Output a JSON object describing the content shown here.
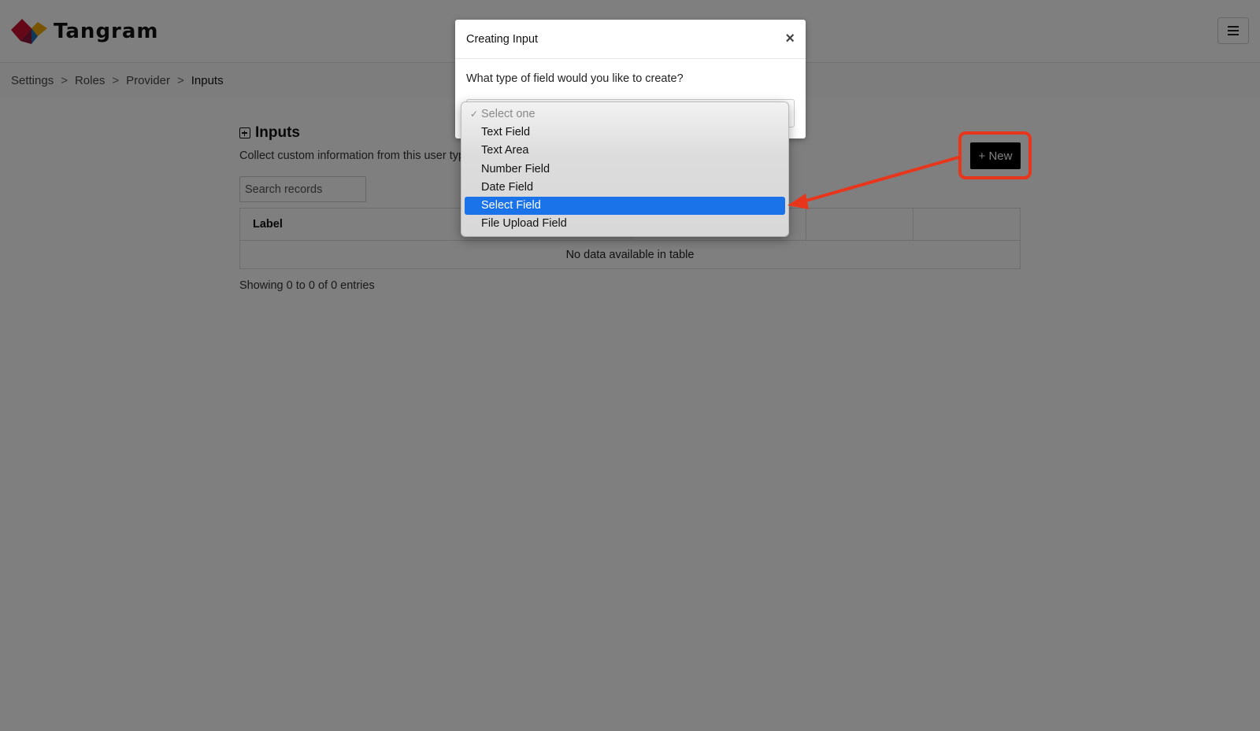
{
  "app": {
    "name": "Tangram",
    "menu_icon": "hamburger-icon"
  },
  "breadcrumb": {
    "items": [
      "Settings",
      "Roles",
      "Provider",
      "Inputs"
    ],
    "separator": ">"
  },
  "section": {
    "title": "Inputs",
    "description": "Collect custom information from this user typ",
    "new_button_label": "+ New"
  },
  "search": {
    "placeholder": "Search records"
  },
  "table": {
    "columns": [
      "Label",
      "",
      "",
      ""
    ],
    "empty_message": "No data available in table",
    "footer": "Showing 0 to 0 of 0 entries"
  },
  "modal": {
    "title": "Creating Input",
    "close_symbol": "×",
    "question": "What type of field would you like to create?"
  },
  "dropdown": {
    "check_symbol": "✓",
    "options": [
      {
        "label": "Select one",
        "state": "placeholder-checked"
      },
      {
        "label": "Text Field",
        "state": "normal"
      },
      {
        "label": "Text Area",
        "state": "normal"
      },
      {
        "label": "Number Field",
        "state": "normal"
      },
      {
        "label": "Date Field",
        "state": "normal"
      },
      {
        "label": "Select Field",
        "state": "highlighted"
      },
      {
        "label": "File Upload Field",
        "state": "normal"
      }
    ]
  },
  "colors": {
    "overlay": "#000000",
    "highlight_option": "#1a73e8",
    "annotation": "#e8361c",
    "logo_red": "#c8102e",
    "logo_gold": "#f2a900",
    "logo_blue": "#1f6fb2"
  }
}
